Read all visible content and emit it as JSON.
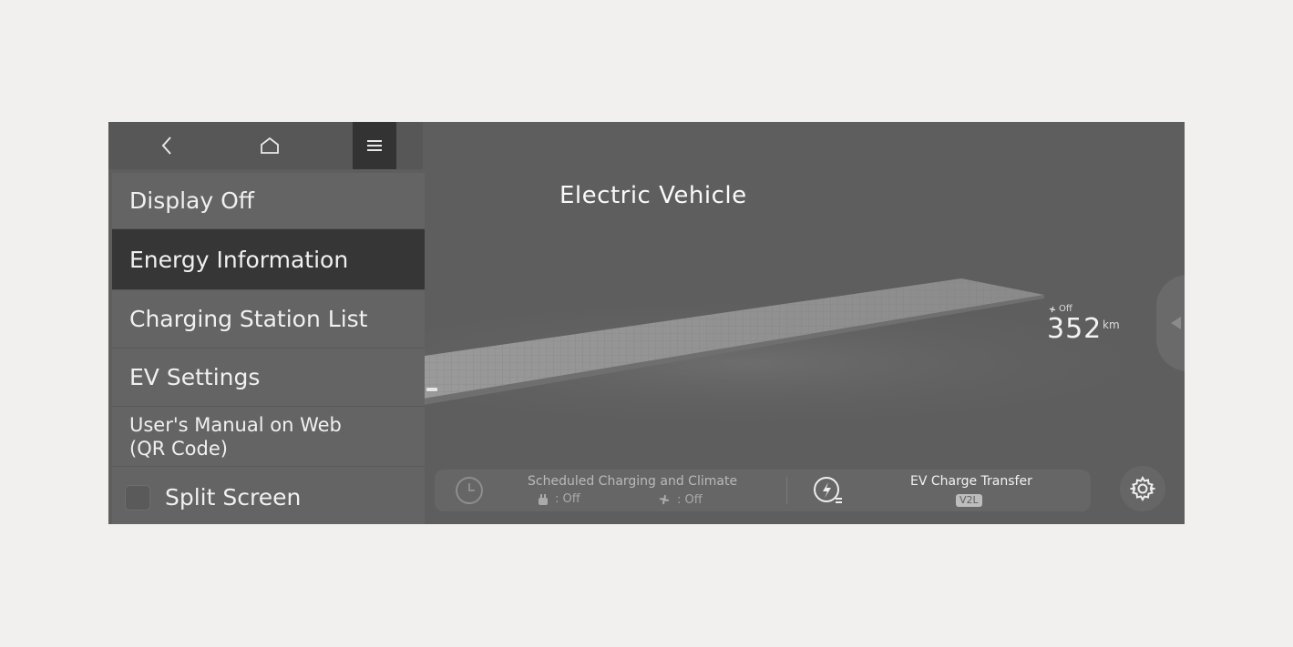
{
  "nav": {
    "back_icon": "chevron-left-icon",
    "home_icon": "home-icon",
    "menu_icon": "hamburger-menu-icon"
  },
  "main": {
    "title": "Electric Vehicle"
  },
  "menu": {
    "items": [
      {
        "label": "Display Off"
      },
      {
        "label": "Energy Information",
        "selected": true
      },
      {
        "label": "Charging Station List"
      },
      {
        "label": "EV Settings"
      },
      {
        "label_line1": "User's Manual on Web",
        "label_line2": "(QR Code)"
      },
      {
        "label": "Split Screen",
        "checked": false
      }
    ]
  },
  "range": {
    "fan_status": "Off",
    "value": "352",
    "unit": "km"
  },
  "bottom_bar": {
    "scheduled_title": "Scheduled Charging and Climate",
    "charging_status": ": Off",
    "climate_status": ": Off",
    "ev_charge_title": "EV Charge Transfer",
    "v2l_badge": "V2L"
  },
  "colors": {
    "screen_bg": "#5e5e5e",
    "selected_bg": "#363636",
    "page_bg": "#f1f0ee"
  }
}
